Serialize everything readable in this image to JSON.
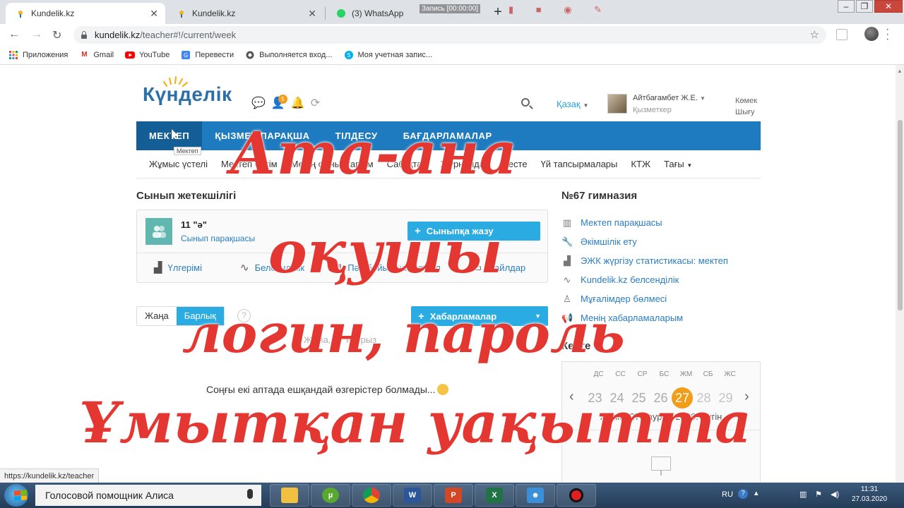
{
  "browser": {
    "tabs": [
      {
        "title": "Kundelik.kz",
        "close": "✕"
      },
      {
        "title": "Kundelik.kz",
        "close": "✕"
      },
      {
        "title": "(3) WhatsApp",
        "close": ""
      }
    ],
    "new_tab": "+",
    "recording_label": "Запись [00:00:00]",
    "url_host": "kundelik.kz",
    "url_path": "/teacher#!/current/week",
    "bookmarks": [
      {
        "label": "Приложения",
        "icon": "apps-grid-icon"
      },
      {
        "label": "Gmail",
        "icon": "gmail-icon"
      },
      {
        "label": "YouTube",
        "icon": "youtube-icon"
      },
      {
        "label": "Перевести",
        "icon": "translate-icon"
      },
      {
        "label": "Выполняется вход...",
        "icon": "globe-icon"
      },
      {
        "label": "Моя учетная запис...",
        "icon": "skype-icon"
      }
    ],
    "status_url": "https://kundelik.kz/teacher"
  },
  "site": {
    "logo": "Күнделік",
    "notification_count": "5",
    "language": "Қазақ",
    "user_name": "Айтбағамбет Ж.Е.",
    "user_role": "Қызметкер",
    "help_line1": "Көмек",
    "help_line2": "Шығу",
    "main_nav": [
      "МЕКТЕП",
      "ҚЫЗМЕТ ПАРАҚША",
      "ТІЛДЕСУ",
      "БАҒДАРЛАМАЛАР"
    ],
    "tooltip": "Мектеп",
    "sub_nav": [
      "Жұмыс үстелі",
      "Мектеп бетім",
      "Менің сыныптарым",
      "Сабақтар",
      "Журналдар",
      "Кесте",
      "Үй тапсырмалары",
      "КТЖ",
      "Тағы"
    ]
  },
  "class_section": {
    "title": "Сынып жетекшілігі",
    "class_name": "11 \"ә\"",
    "class_link": "Сынып парақшасы",
    "write_button": "Сыныпқа жазу",
    "actions": [
      {
        "label": "Үлгерімі",
        "icon": "chart-icon"
      },
      {
        "label": "Белсенділік",
        "icon": "pulse-icon"
      },
      {
        "label": "Пән бойынша журнал",
        "icon": "journal-icon"
      },
      {
        "label": "Файлдар",
        "icon": "folder-icon"
      }
    ]
  },
  "feed": {
    "toggle_new": "Жаңа",
    "toggle_all": "Барлық",
    "help_mark": "?",
    "messages_button": "Хабарламалар",
    "date_line": "Жұма, 27 наурыз",
    "empty_text": "Соңғы екі аптада ешқандай өзгерістер болмады..."
  },
  "school": {
    "title": "№67 гимназия",
    "links": [
      {
        "label": "Мектеп парақшасы",
        "icon": "building-icon"
      },
      {
        "label": "Әкімшілік ету",
        "icon": "wrench-icon"
      },
      {
        "label": "ЭЖК жүргізу статистикасы: мектеп",
        "icon": "stats-icon"
      },
      {
        "label": "Kundelik.kz белсенділік",
        "icon": "pulse-icon"
      },
      {
        "label": "Мұғалімдер бөлмесі",
        "icon": "teacher-icon"
      },
      {
        "label": "Менің хабарламаларым",
        "icon": "megaphone-icon"
      }
    ]
  },
  "schedule": {
    "title": "Кесте",
    "dows": [
      "ДС",
      "СС",
      "СР",
      "БС",
      "ЖМ",
      "СБ",
      "ЖС"
    ],
    "days": [
      "23",
      "24",
      "25",
      "26",
      "27",
      "28",
      "29"
    ],
    "today_index": 4,
    "today_line": "Жұма, 27 наурыз 2020. Бүгін"
  },
  "overlay": {
    "line1": "Ата-ана",
    "line2": "оқушы",
    "line3": "логин, пароль",
    "line4": "Ұмытқан уақытта"
  },
  "taskbar": {
    "assistant": "Голосовой помощник Алиса",
    "lang": "RU",
    "time": "11:31",
    "date": "27.03.2020"
  },
  "colors": {
    "nav_blue": "#1e7bbf",
    "accent_cyan": "#2aabe2",
    "today_orange": "#f29d1a",
    "overlay_red": "#e53731"
  }
}
